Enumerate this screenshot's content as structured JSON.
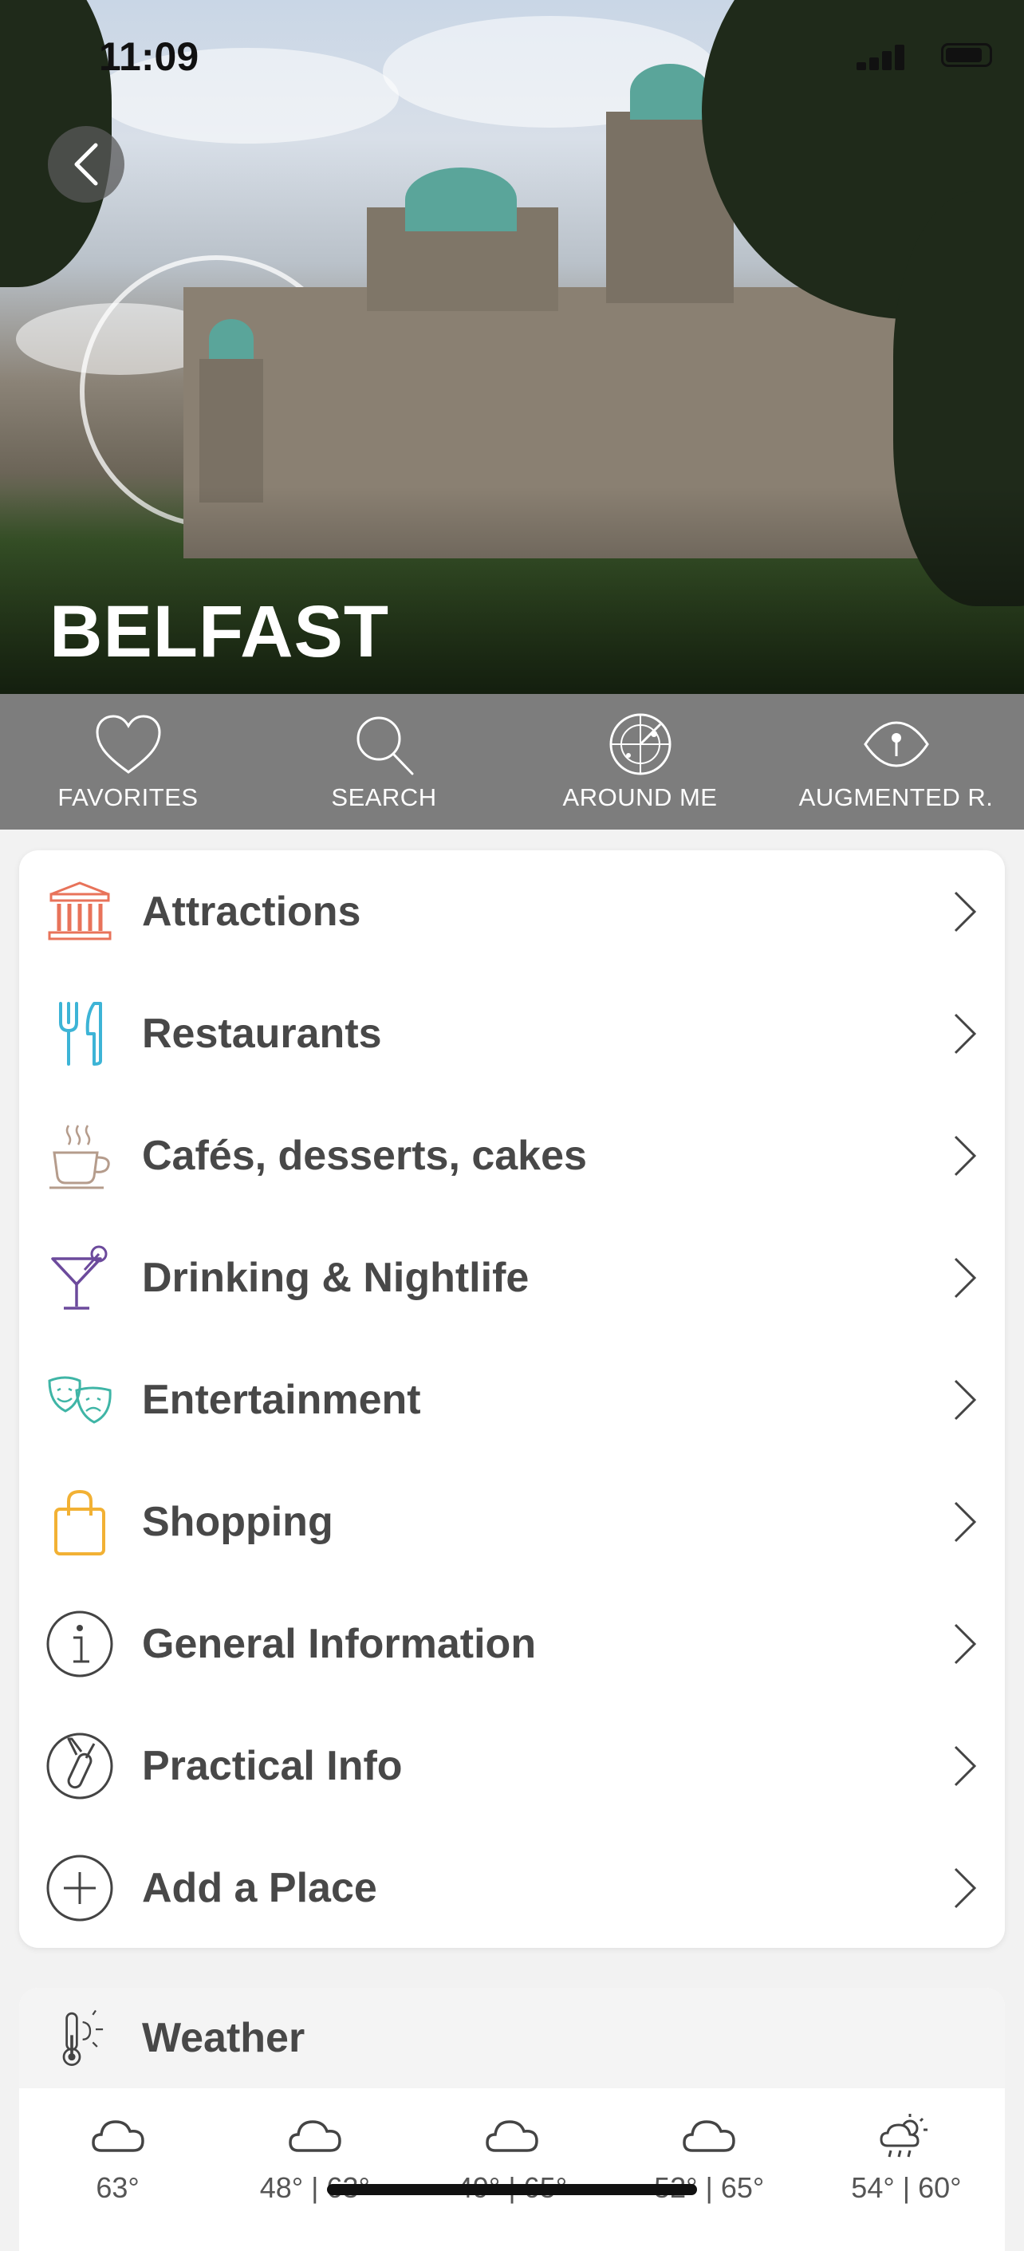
{
  "status_bar": {
    "time": "11:09"
  },
  "hero": {
    "title": "BELFAST",
    "image_description_icon": "city-hall-photo"
  },
  "toolbar": {
    "items": [
      {
        "label": "FAVORITES",
        "icon": "heart-icon"
      },
      {
        "label": "SEARCH",
        "icon": "search-icon"
      },
      {
        "label": "AROUND ME",
        "icon": "radar-icon"
      },
      {
        "label": "AUGMENTED R.",
        "icon": "eye-icon"
      }
    ]
  },
  "menu": {
    "items": [
      {
        "label": "Attractions",
        "icon": "temple-icon",
        "color": "#e8735a"
      },
      {
        "label": "Restaurants",
        "icon": "fork-knife-icon",
        "color": "#3db4d6"
      },
      {
        "label": "Cafés, desserts, cakes",
        "icon": "coffee-cup-icon",
        "color": "#b59c8c"
      },
      {
        "label": "Drinking & Nightlife",
        "icon": "cocktail-icon",
        "color": "#6c4a9c"
      },
      {
        "label": "Entertainment",
        "icon": "theater-masks-icon",
        "color": "#3fb5a6"
      },
      {
        "label": "Shopping",
        "icon": "shopping-bag-icon",
        "color": "#f2b134"
      },
      {
        "label": "General Information",
        "icon": "info-icon",
        "color": "#444444"
      },
      {
        "label": "Practical Info",
        "icon": "swiss-knife-icon",
        "color": "#444444"
      },
      {
        "label": "Add a Place",
        "icon": "plus-circle-icon",
        "color": "#444444"
      }
    ]
  },
  "weather": {
    "title": "Weather",
    "days": [
      {
        "temp": "63°",
        "icon": "cloud-icon"
      },
      {
        "temp": "48° | 63°",
        "icon": "cloud-icon"
      },
      {
        "temp": "49° | 65°",
        "icon": "cloud-icon"
      },
      {
        "temp": "52° | 65°",
        "icon": "cloud-icon"
      },
      {
        "temp": "54° | 60°",
        "icon": "sun-rain-icon"
      }
    ]
  }
}
